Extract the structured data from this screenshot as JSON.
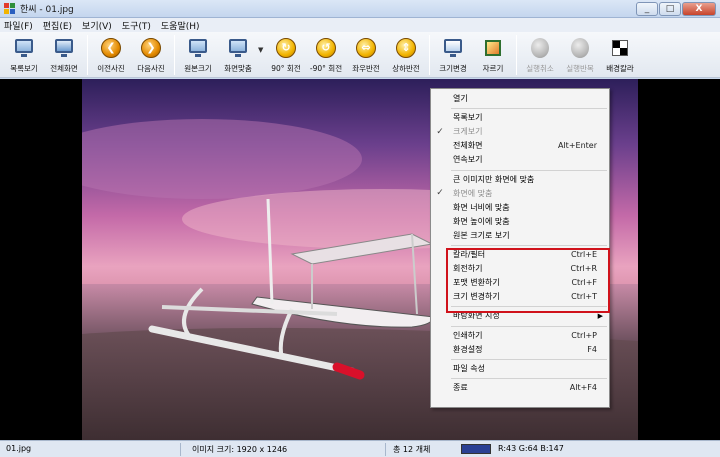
{
  "window": {
    "title": "한씨 - 01.jpg",
    "btn_min": "_",
    "btn_max": "□",
    "btn_close": "X"
  },
  "menubar": [
    "파일(F)",
    "편집(E)",
    "보기(V)",
    "도구(T)",
    "도움말(H)"
  ],
  "toolbar": {
    "items": [
      {
        "label": "목록보기",
        "icon": "screen-icon"
      },
      {
        "label": "전체화면",
        "icon": "screen-icon"
      },
      {
        "label": "이전사진",
        "icon": "prev-icon",
        "glyph": "❮"
      },
      {
        "label": "다음사진",
        "icon": "next-icon",
        "glyph": "❯"
      },
      {
        "label": "원본크기",
        "icon": "screen-icon"
      },
      {
        "label": "화면맞춤",
        "icon": "screen-icon",
        "dropdown": "▼"
      },
      {
        "label": "90° 회전",
        "icon": "rotate-cw-icon",
        "glyph": "↻"
      },
      {
        "label": "-90° 회전",
        "icon": "rotate-ccw-icon",
        "glyph": "↺"
      },
      {
        "label": "좌우반전",
        "icon": "flip-horizontal-icon",
        "glyph": "⇔"
      },
      {
        "label": "상하반전",
        "icon": "flip-vertical-icon",
        "glyph": "⇕"
      },
      {
        "label": "크기변경",
        "icon": "screen-icon"
      },
      {
        "label": "자르기",
        "icon": "crop-icon"
      },
      {
        "label": "실행취소",
        "icon": "undo-icon",
        "disabled": true
      },
      {
        "label": "실행반복",
        "icon": "redo-icon",
        "disabled": true
      },
      {
        "label": "배경칼라",
        "icon": "background-color-icon"
      }
    ]
  },
  "context_menu": {
    "items": [
      {
        "label": "열기"
      },
      {
        "sep": true
      },
      {
        "label": "목록보기"
      },
      {
        "label": "크게보기",
        "checked": true,
        "disabled": true
      },
      {
        "label": "전체화면",
        "shortcut": "Alt+Enter"
      },
      {
        "label": "연속보기"
      },
      {
        "sep": true
      },
      {
        "label": "큰 이미지만 화면에 맞춤"
      },
      {
        "label": "화면에 맞춤",
        "checked": true,
        "disabled": true
      },
      {
        "label": "화면 너비에 맞춤"
      },
      {
        "label": "화면 높이에 맞춤"
      },
      {
        "label": "원본 크기로 보기"
      },
      {
        "sep": true
      },
      {
        "label": "칼라/필터",
        "shortcut": "Ctrl+E"
      },
      {
        "label": "회전하기",
        "shortcut": "Ctrl+R"
      },
      {
        "label": "포맷 변환하기",
        "shortcut": "Ctrl+F"
      },
      {
        "label": "크기 변경하기",
        "shortcut": "Ctrl+T"
      },
      {
        "sep": true
      },
      {
        "label": "바탕화면 지정",
        "submenu": "▶"
      },
      {
        "sep": true
      },
      {
        "label": "인쇄하기",
        "shortcut": "Ctrl+P"
      },
      {
        "label": "환경설정",
        "shortcut": "F4"
      },
      {
        "sep": true
      },
      {
        "label": "파일 속성"
      },
      {
        "sep": true
      },
      {
        "label": "종료",
        "shortcut": "Alt+F4"
      }
    ]
  },
  "status": {
    "filename": "01.jpg",
    "image_size": "이미지 크기: 1920 x 1246",
    "total": "총 12 개체",
    "rgb": "R:43 G:64 B:147",
    "swatch_color": "#2b4093"
  },
  "colors": {
    "highlight": "#d0121b",
    "accent": "#3a5a8a"
  }
}
